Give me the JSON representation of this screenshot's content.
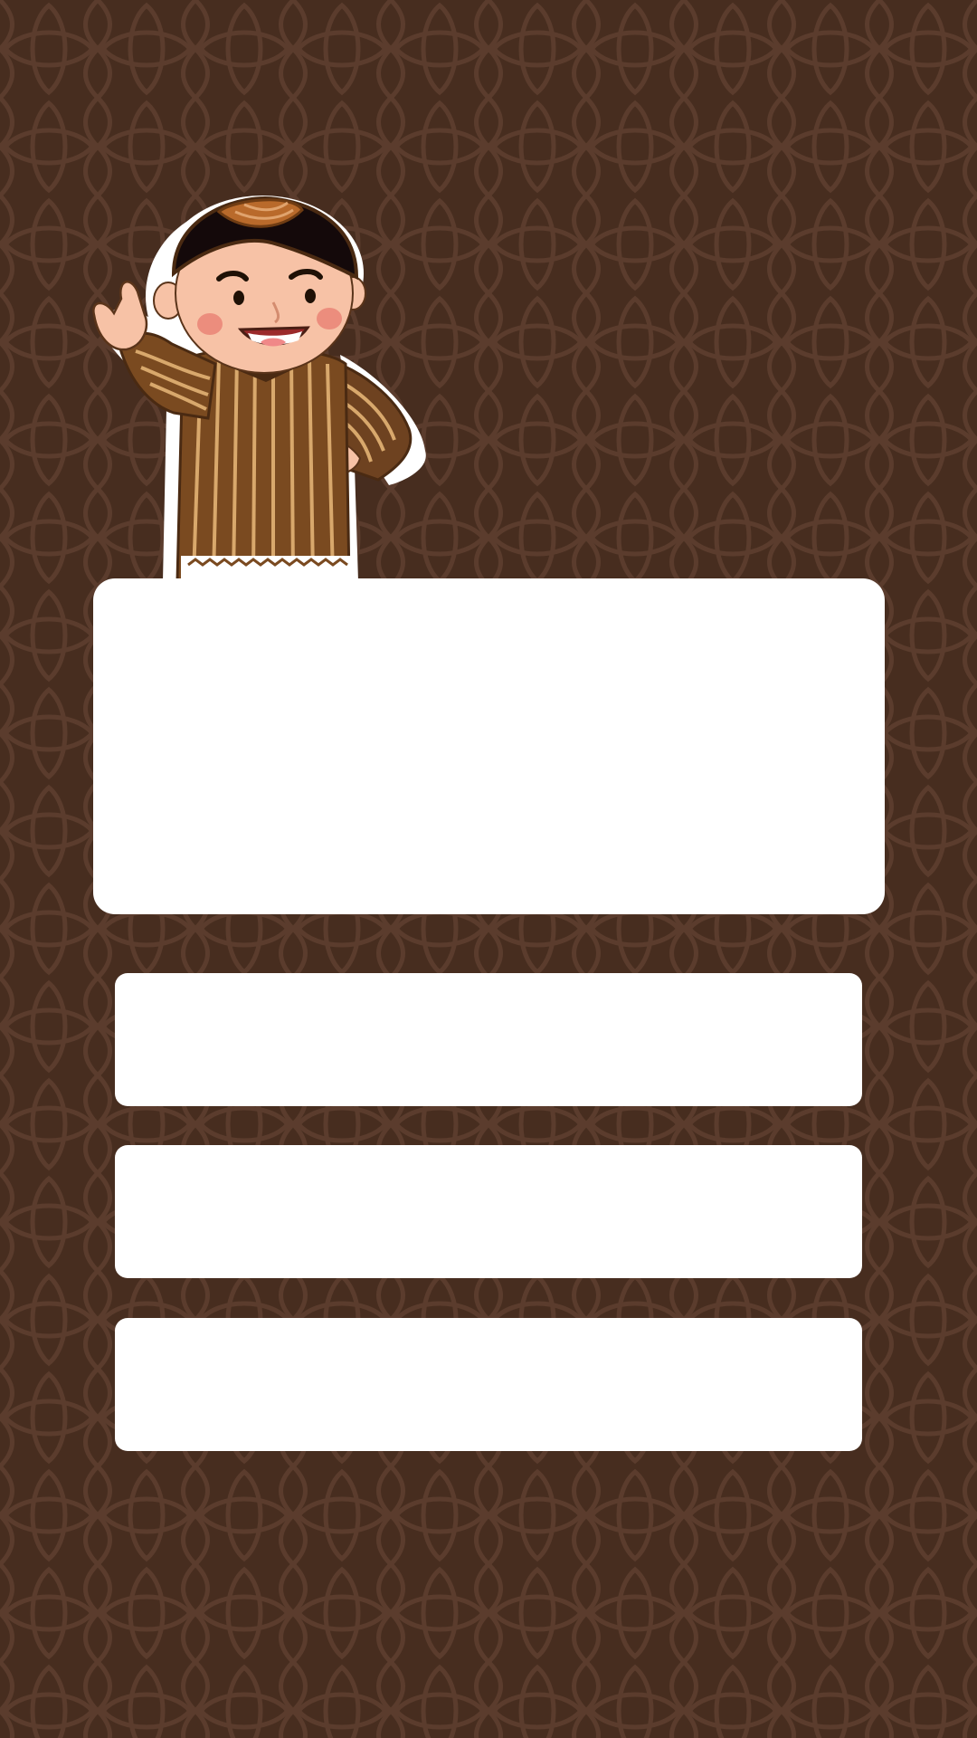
{
  "colors": {
    "background": "#472d1f",
    "pattern": "#5b3d2d",
    "card": "#ffffff"
  },
  "mascot": {
    "icon": "javanese-boy-mascot-icon"
  },
  "main_card": {
    "text": ""
  },
  "options": [
    {
      "text": ""
    },
    {
      "text": ""
    },
    {
      "text": ""
    }
  ]
}
